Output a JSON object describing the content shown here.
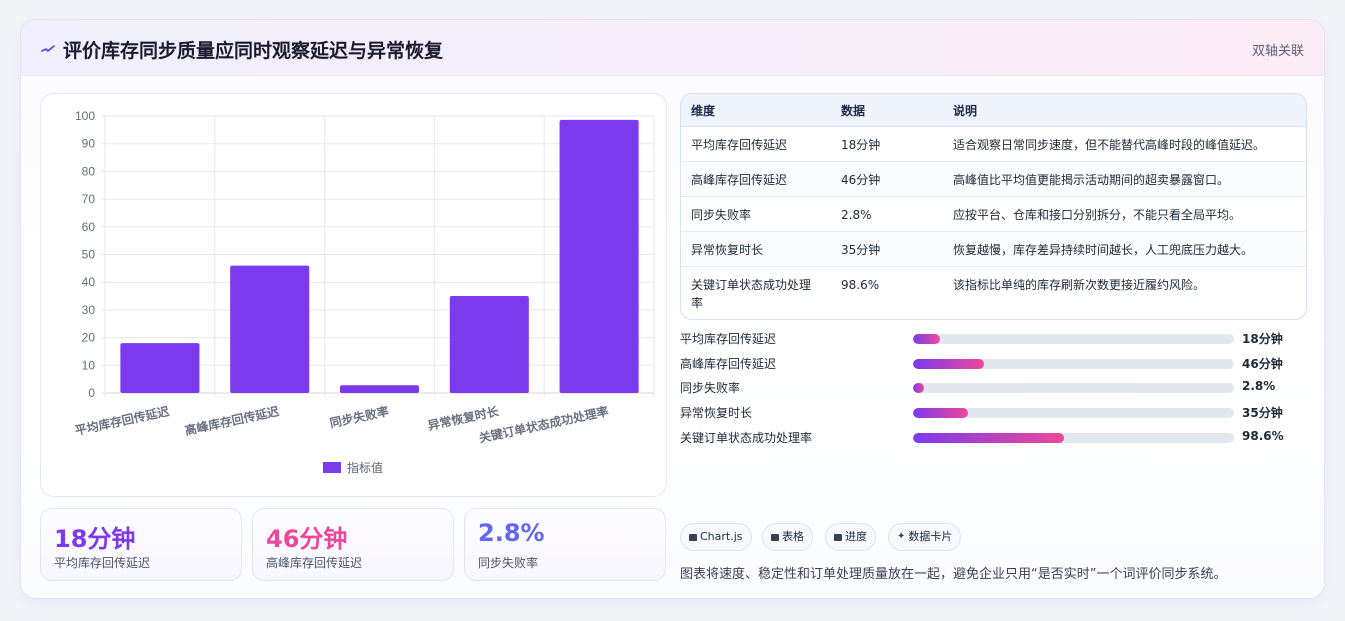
{
  "header": {
    "title": "评价库存同步质量应同时观察延迟与异常恢复",
    "tag": "双轴关联"
  },
  "colors": {
    "accent_purple": "#7c3aed",
    "accent_pink": "#ec4899",
    "accent_indigo": "#6366f1"
  },
  "chart_data": {
    "type": "bar",
    "categories": [
      "平均库存回传延迟",
      "高峰库存回传延迟",
      "同步失败率",
      "异常恢复时长",
      "关键订单状态成功处理率"
    ],
    "series": [
      {
        "name": "指标值",
        "values": [
          18,
          46,
          2.8,
          35,
          98.6
        ],
        "color": "#7c3aed"
      }
    ],
    "ylim": [
      0,
      100
    ],
    "yticks": [
      "0",
      "10",
      "20",
      "30",
      "40",
      "50",
      "60",
      "70",
      "80",
      "90",
      "100"
    ],
    "grid": true,
    "legend": "bottom"
  },
  "kpis": [
    {
      "value": "18分钟",
      "label": "平均库存回传延迟",
      "color": "#7c3aed"
    },
    {
      "value": "46分钟",
      "label": "高峰库存回传延迟",
      "color": "#ec4899"
    },
    {
      "value": "2.8%",
      "label": "同步失败率",
      "color": "#6366f1"
    }
  ],
  "table": {
    "headers": [
      "维度",
      "数据",
      "说明"
    ],
    "rows": [
      [
        "平均库存回传延迟",
        "18分钟",
        "适合观察日常同步速度，但不能替代高峰时段的峰值延迟。"
      ],
      [
        "高峰库存回传延迟",
        "46分钟",
        "高峰值比平均值更能揭示活动期间的超卖暴露窗口。"
      ],
      [
        "同步失败率",
        "2.8%",
        "应按平台、仓库和接口分别拆分，不能只看全局平均。"
      ],
      [
        "异常恢复时长",
        "35分钟",
        "恢复越慢，库存差异持续时间越长，人工兜底压力越大。"
      ],
      [
        "关键订单状态成功处理率",
        "98.6%",
        "该指标比单纯的库存刷新次数更接近履约风险。"
      ]
    ]
  },
  "progress": [
    {
      "label": "平均库存回传延迟",
      "value": "18分钟",
      "percent": 8.5
    },
    {
      "label": "高峰库存回传延迟",
      "value": "46分钟",
      "percent": 22
    },
    {
      "label": "同步失败率",
      "value": "2.8%",
      "percent": 3.5
    },
    {
      "label": "异常恢复时长",
      "value": "35分钟",
      "percent": 17
    },
    {
      "label": "关键订单状态成功处理率",
      "value": "98.6%",
      "percent": 47
    }
  ],
  "chips": [
    {
      "label": "Chart.js",
      "icon": "chart-icon"
    },
    {
      "label": "表格",
      "icon": "table-icon"
    },
    {
      "label": "进度",
      "icon": "progress-icon"
    },
    {
      "label": "数据卡片",
      "icon": "sparkle-icon"
    }
  ],
  "footnote": "图表将速度、稳定性和订单处理质量放在一起，避免企业只用“是否实时”一个词评价同步系统。"
}
